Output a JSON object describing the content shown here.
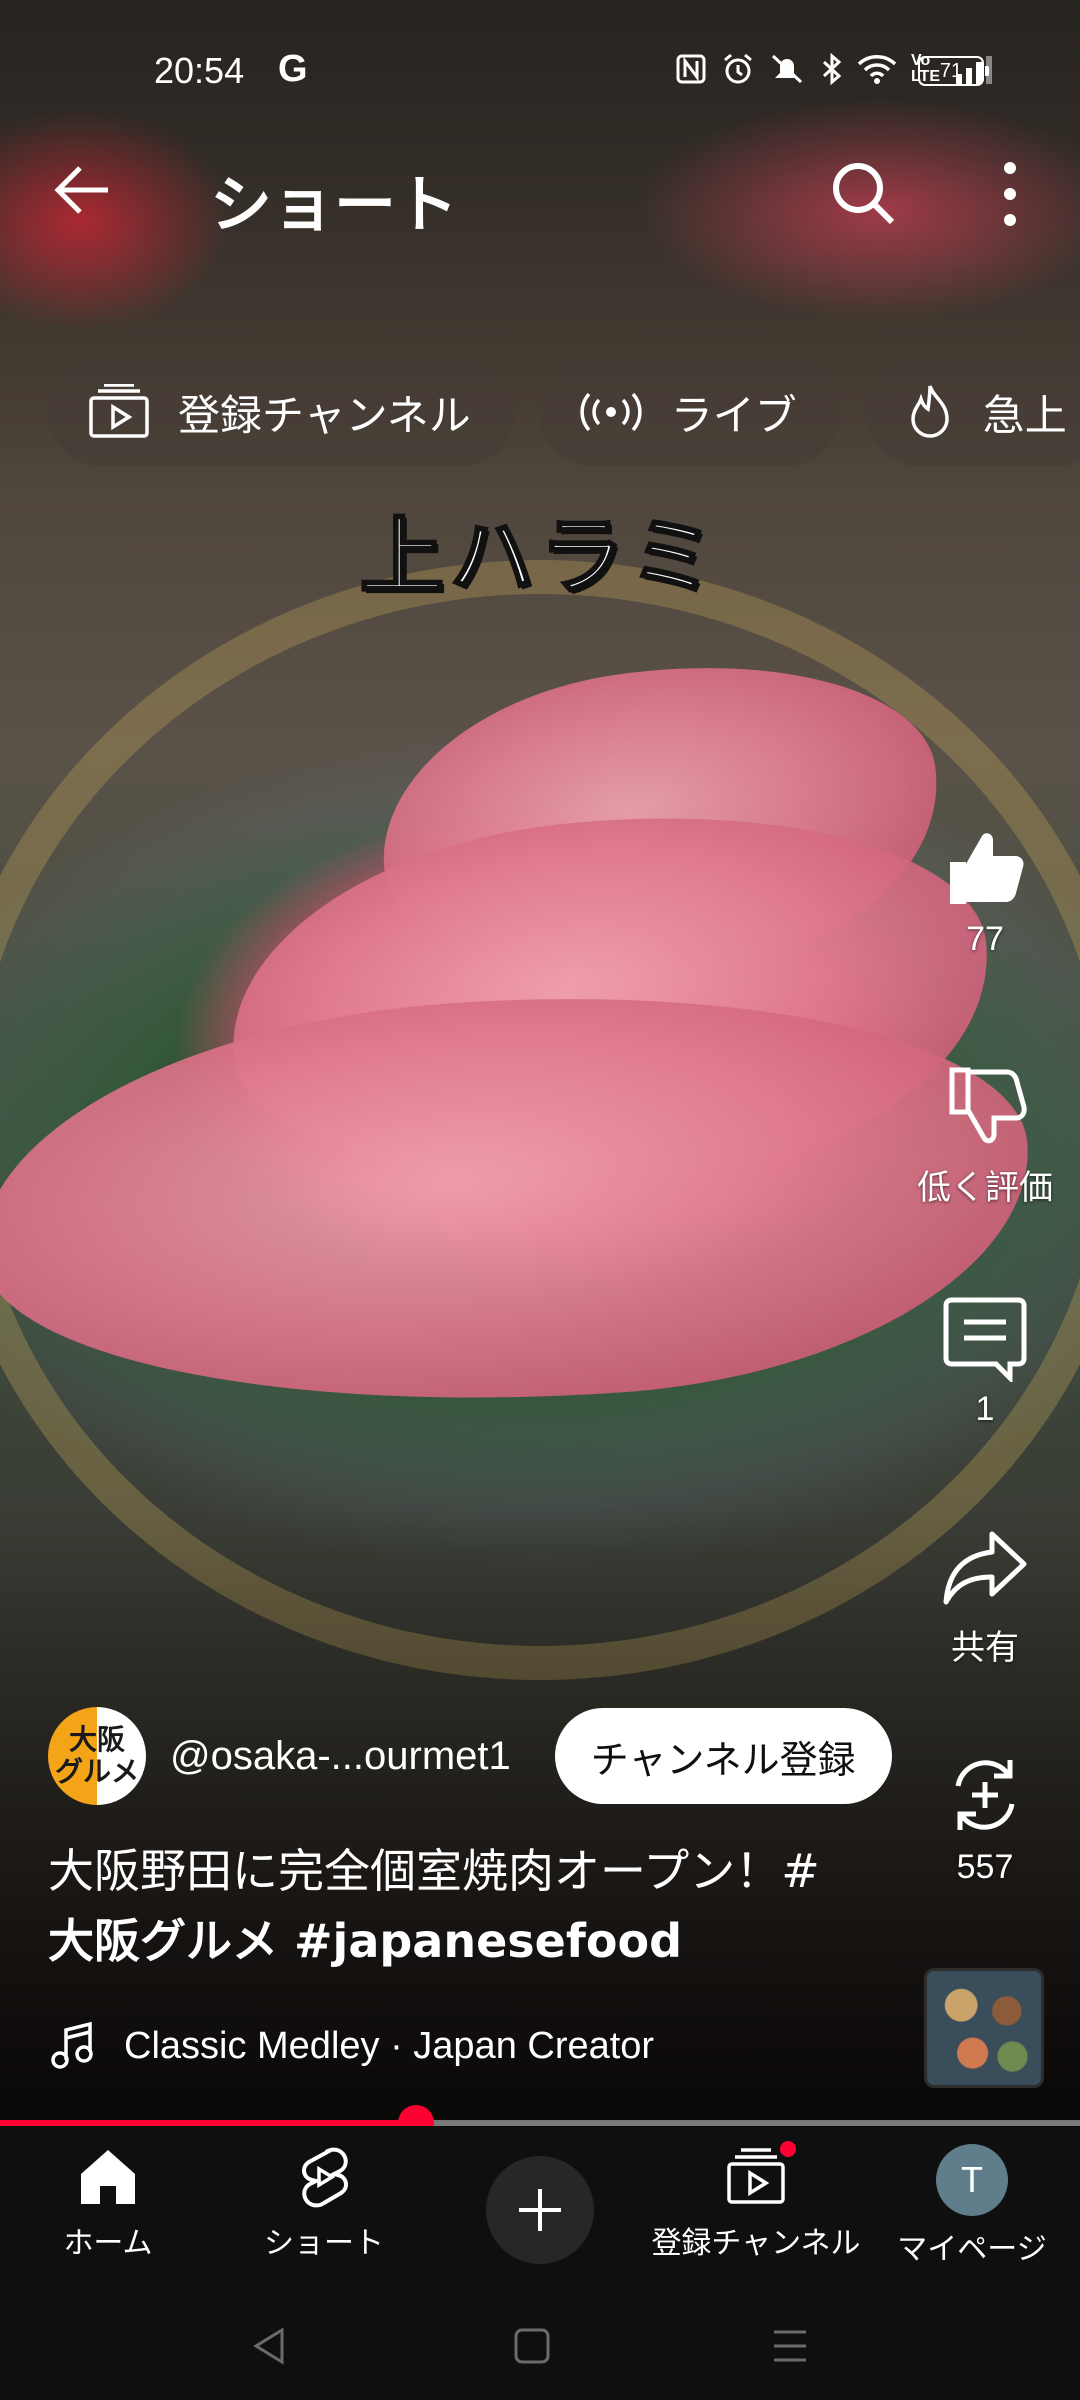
{
  "status_bar": {
    "time": "20:54",
    "g_label": "G",
    "icons": [
      "nfc-icon",
      "alarm-icon",
      "mute-icon",
      "bluetooth-icon",
      "wifi-icon",
      "volte-icon",
      "signal-icon"
    ],
    "volte_label": "Vo\nLTE",
    "battery": "71"
  },
  "header": {
    "title": "ショート"
  },
  "chips": [
    {
      "label": "登録チャンネル",
      "icon": "subscriptions-icon"
    },
    {
      "label": "ライブ",
      "icon": "live-icon"
    },
    {
      "label": "急上",
      "icon": "trending-icon"
    }
  ],
  "video": {
    "overlay_text": "上ハラミ"
  },
  "actions": {
    "like_count": "77",
    "dislike_label": "低く評価",
    "comment_count": "1",
    "share_label": "共有",
    "remix_count": "557"
  },
  "channel": {
    "avatar_text": "大阪\nグルメ",
    "name": "@osaka-...ourmet1",
    "subscribe_label": "チャンネル登録"
  },
  "caption": {
    "line1": "大阪野田に完全個室焼肉オープン！#",
    "line2": "大阪グルメ #japanesefood"
  },
  "music": {
    "title": "Classic Medley · Japan Creator"
  },
  "progress": {
    "fraction": 0.385
  },
  "bottom_nav": {
    "home": "ホーム",
    "shorts": "ショート",
    "subscriptions": "登録チャンネル",
    "mypage": "マイページ",
    "avatar_letter": "T"
  },
  "colors": {
    "accent": "#ff0033",
    "nav_bg": "#0f0f0f",
    "chip_bg": "rgba(70,60,55,0.55)"
  }
}
